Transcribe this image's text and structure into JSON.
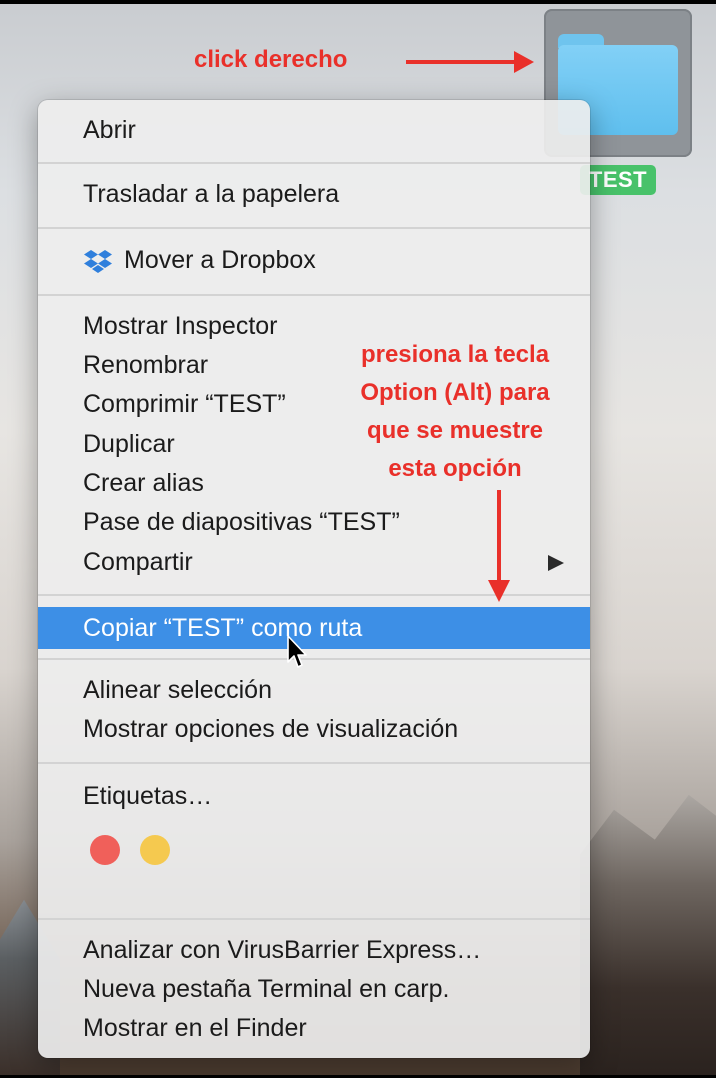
{
  "folder": {
    "name": "TEST"
  },
  "annotations": {
    "click_derecho": "click derecho",
    "option_lines": [
      "presiona la tecla",
      "Option (Alt) para",
      "que se muestre",
      "esta opción"
    ]
  },
  "menu": {
    "items": [
      {
        "label": "Abrir"
      },
      {
        "label": "Trasladar a la papelera"
      },
      {
        "label": "Mover a Dropbox",
        "icon": "dropbox-icon"
      },
      {
        "label": "Mostrar Inspector"
      },
      {
        "label": "Renombrar"
      },
      {
        "label": "Comprimir “TEST”"
      },
      {
        "label": "Duplicar"
      },
      {
        "label": "Crear alias"
      },
      {
        "label": "Pase de diapositivas “TEST”"
      },
      {
        "label": "Compartir",
        "submenu": true
      },
      {
        "label": "Copiar “TEST” como ruta",
        "highlighted": true
      },
      {
        "label": "Alinear selección"
      },
      {
        "label": "Mostrar opciones de visualización"
      },
      {
        "label": "Etiquetas…"
      },
      {
        "label": "Analizar con VirusBarrier Express…"
      },
      {
        "label": "Nueva pestaña Terminal en carp."
      },
      {
        "label": "Mostrar en el Finder"
      }
    ],
    "tag_colors": [
      "#f0605a",
      "#f5c94f"
    ],
    "highlight_color": "#3d8fe6"
  }
}
